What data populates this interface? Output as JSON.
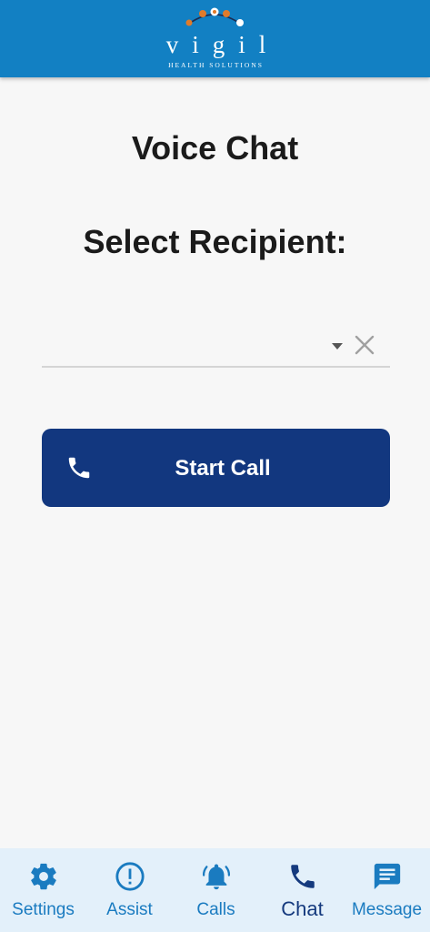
{
  "header": {
    "brand_name": "vigil",
    "brand_tagline": "HEALTH SOLUTIONS"
  },
  "main": {
    "title": "Voice Chat",
    "select_label": "Select Recipient:",
    "recipient_value": "",
    "start_call_label": "Start Call"
  },
  "tabbar": {
    "items": [
      {
        "label": "Settings",
        "icon": "gear-icon"
      },
      {
        "label": "Assist",
        "icon": "alert-circle-icon"
      },
      {
        "label": "Calls",
        "icon": "bell-ringing-icon"
      },
      {
        "label": "Chat",
        "icon": "phone-icon"
      },
      {
        "label": "Message",
        "icon": "message-icon"
      }
    ],
    "active": "Chat"
  },
  "colors": {
    "header": "#1280c3",
    "button": "#12377f",
    "tab_inactive": "#1a7bc0",
    "tab_active": "#153a7e"
  }
}
